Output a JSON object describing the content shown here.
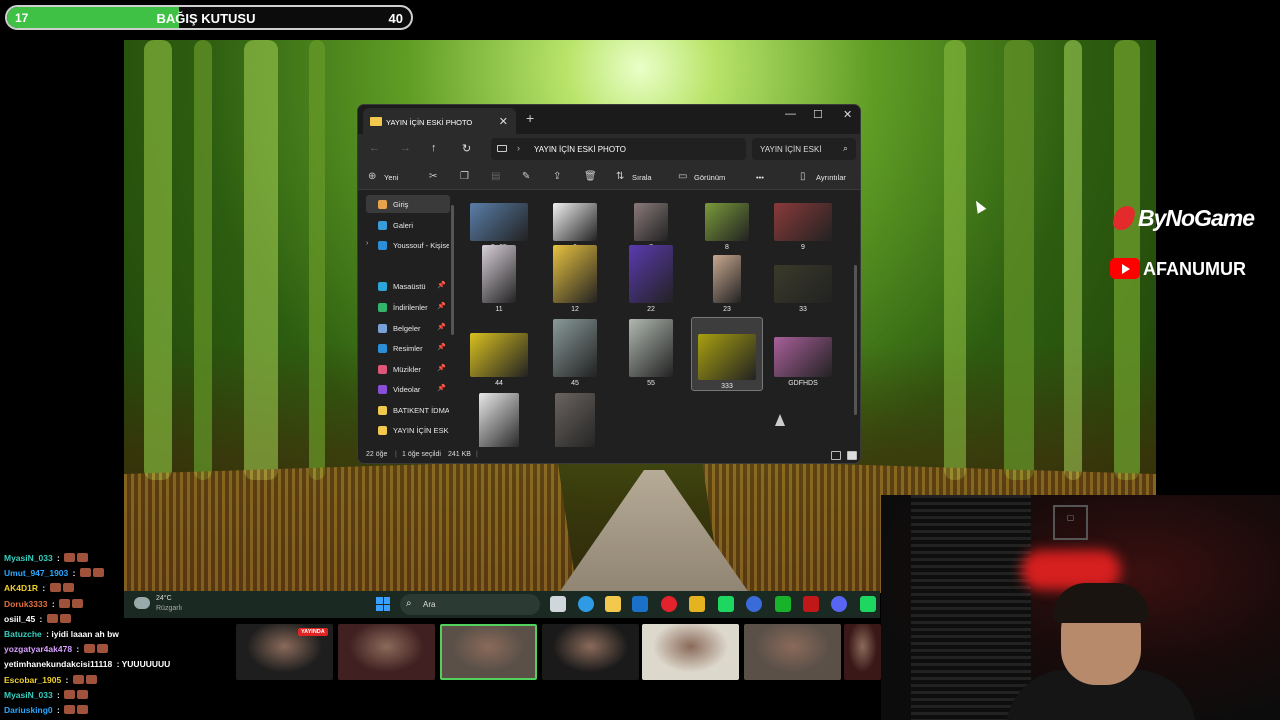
{
  "donation": {
    "count": "17",
    "title": "BAĞIŞ KUTUSU",
    "goal": "40",
    "progress": 0.425,
    "color": "#3fc145"
  },
  "explorer": {
    "tab_title": "YAYIN İÇİN ESKİ PHOTO",
    "tab_close": "✕",
    "new_tab": "+",
    "controls": {
      "minimize": "—",
      "maximize": "☐",
      "close": "✕"
    },
    "nav": {
      "back": "←",
      "forward": "→",
      "up": "↑",
      "refresh": "↻"
    },
    "breadcrumb": "YAYIN İÇİN ESKİ PHOTO",
    "search_placeholder": "YAYIN İÇİN ESKİ",
    "command": {
      "new": "Yeni",
      "sort": "Sırala",
      "view": "Görünüm",
      "more": "•••",
      "details": "Ayrıntılar"
    },
    "sidebar": [
      {
        "label": "Giriş",
        "icon": "home-icon",
        "color": "#e8a24a",
        "selected": true,
        "pinned": false
      },
      {
        "label": "Galeri",
        "icon": "gallery-icon",
        "color": "#3a9bd9",
        "pinned": false
      },
      {
        "label": "Youssouf - Kişisel",
        "icon": "cloud-icon",
        "color": "#2a8fd6",
        "pinned": false,
        "expand": "›"
      },
      {
        "label": "Masaüstü",
        "icon": "desktop-icon",
        "color": "#2ba5d8",
        "pinned": true
      },
      {
        "label": "İndirilenler",
        "icon": "download-icon",
        "color": "#33b46c",
        "pinned": true
      },
      {
        "label": "Belgeler",
        "icon": "documents-icon",
        "color": "#7aa0d8",
        "pinned": true
      },
      {
        "label": "Resimler",
        "icon": "pictures-icon",
        "color": "#2a8fd6",
        "pinned": true
      },
      {
        "label": "Müzikler",
        "icon": "music-icon",
        "color": "#e0557a",
        "pinned": true
      },
      {
        "label": "Videolar",
        "icon": "video-icon",
        "color": "#8a4fd8",
        "pinned": true
      },
      {
        "label": "BATIKENT İDMAN",
        "icon": "folder-icon",
        "color": "#f2c94c",
        "pinned": false
      },
      {
        "label": "YAYIN İÇİN ESKİ",
        "icon": "folder-icon",
        "color": "#f2c94c",
        "pinned": false
      }
    ],
    "files": [
      {
        "name": "5+65",
        "color": "#5a7ea8"
      },
      {
        "name": "6",
        "color": "#f0f0f0"
      },
      {
        "name": "7",
        "color": "#8a7a7a"
      },
      {
        "name": "8",
        "color": "#7a9a3a"
      },
      {
        "name": "9",
        "color": "#8a3a3a"
      },
      {
        "name": "11",
        "color": "#d8d0d8"
      },
      {
        "name": "12",
        "color": "#e8c240"
      },
      {
        "name": "22",
        "color": "#5a3ab0"
      },
      {
        "name": "23",
        "color": "#c8a890"
      },
      {
        "name": "33",
        "color": "#3a3a2a"
      },
      {
        "name": "44",
        "color": "#d8c020"
      },
      {
        "name": "45",
        "color": "#8a9a9a"
      },
      {
        "name": "55",
        "color": "#b0b8b0"
      },
      {
        "name": "333",
        "color": "#a8a010",
        "selected": true
      },
      {
        "name": "GDFHDS",
        "color": "#a8609a"
      },
      {
        "name": "",
        "color": "#e8e8e8"
      },
      {
        "name": "",
        "color": "#6a6460"
      }
    ],
    "status": {
      "count": "22 öğe",
      "selected": "1 öğe seçildi",
      "size": "241 KB"
    }
  },
  "taskbar": {
    "weather_temp": "24°C",
    "weather_desc": "Rüzgarlı",
    "search": "Ara",
    "apps": [
      {
        "name": "task-view-icon",
        "color": "#cfd6dc"
      },
      {
        "name": "edge-icon",
        "color": "#2f9be4"
      },
      {
        "name": "file-explorer-icon",
        "color": "#f2c94c"
      },
      {
        "name": "outlook-icon",
        "color": "#1b70c8"
      },
      {
        "name": "opera-icon",
        "color": "#e3222b"
      },
      {
        "name": "chrome-icon",
        "color": "#e6b320"
      },
      {
        "name": "spotify-icon",
        "color": "#1ed760"
      },
      {
        "name": "triangle-app-icon",
        "color": "#3a6bd8"
      },
      {
        "name": "green-app-icon",
        "color": "#18b32a"
      },
      {
        "name": "red-app-icon",
        "color": "#c01818"
      },
      {
        "name": "discord-icon",
        "color": "#5865f2"
      },
      {
        "name": "spotify-icon",
        "color": "#1ed760"
      }
    ]
  },
  "overlay": {
    "brand_bynogame": "ByNoGame",
    "brand_youtube": "AFANUMUR",
    "live_badge": "YAYINDA",
    "channels": [
      {
        "color": "#1e1e1e",
        "selected": false
      },
      {
        "color": "#402020",
        "selected": false
      },
      {
        "color": "#5a5048",
        "selected": true
      },
      {
        "color": "#1a1a1a",
        "selected": false
      },
      {
        "color": "#ddd8cc",
        "selected": false
      },
      {
        "color": "#5a5048",
        "selected": false
      },
      {
        "color": "#3a1818",
        "selected": false
      }
    ]
  },
  "chat": [
    {
      "user": "MyasiN_033",
      "text": "",
      "color": "#35d0c0"
    },
    {
      "user": "Umut_947_1903",
      "text": "",
      "color": "#2aa8ff"
    },
    {
      "user": "AK4D1R",
      "text": "",
      "color": "#f0d030"
    },
    {
      "user": "Doruk3333",
      "text": "",
      "color": "#e07040"
    },
    {
      "user": "osiil_45",
      "text": "",
      "color": "#ffffff"
    },
    {
      "user": "Batuzche",
      "text": "iyidi laaan ah bw",
      "color": "#35d0c0"
    },
    {
      "user": "yozgatyar4ak478",
      "text": "",
      "color": "#d8a0ff"
    },
    {
      "user": "yetimhanekundakcisi11118",
      "text": "YUUUUUUU",
      "color": "#ffffff"
    },
    {
      "user": "Escobar_1905",
      "text": "",
      "color": "#f0d030"
    },
    {
      "user": "MyasiN_033",
      "text": "",
      "color": "#35d0c0"
    },
    {
      "user": "Dariusking0",
      "text": "",
      "color": "#2aa8ff"
    }
  ]
}
